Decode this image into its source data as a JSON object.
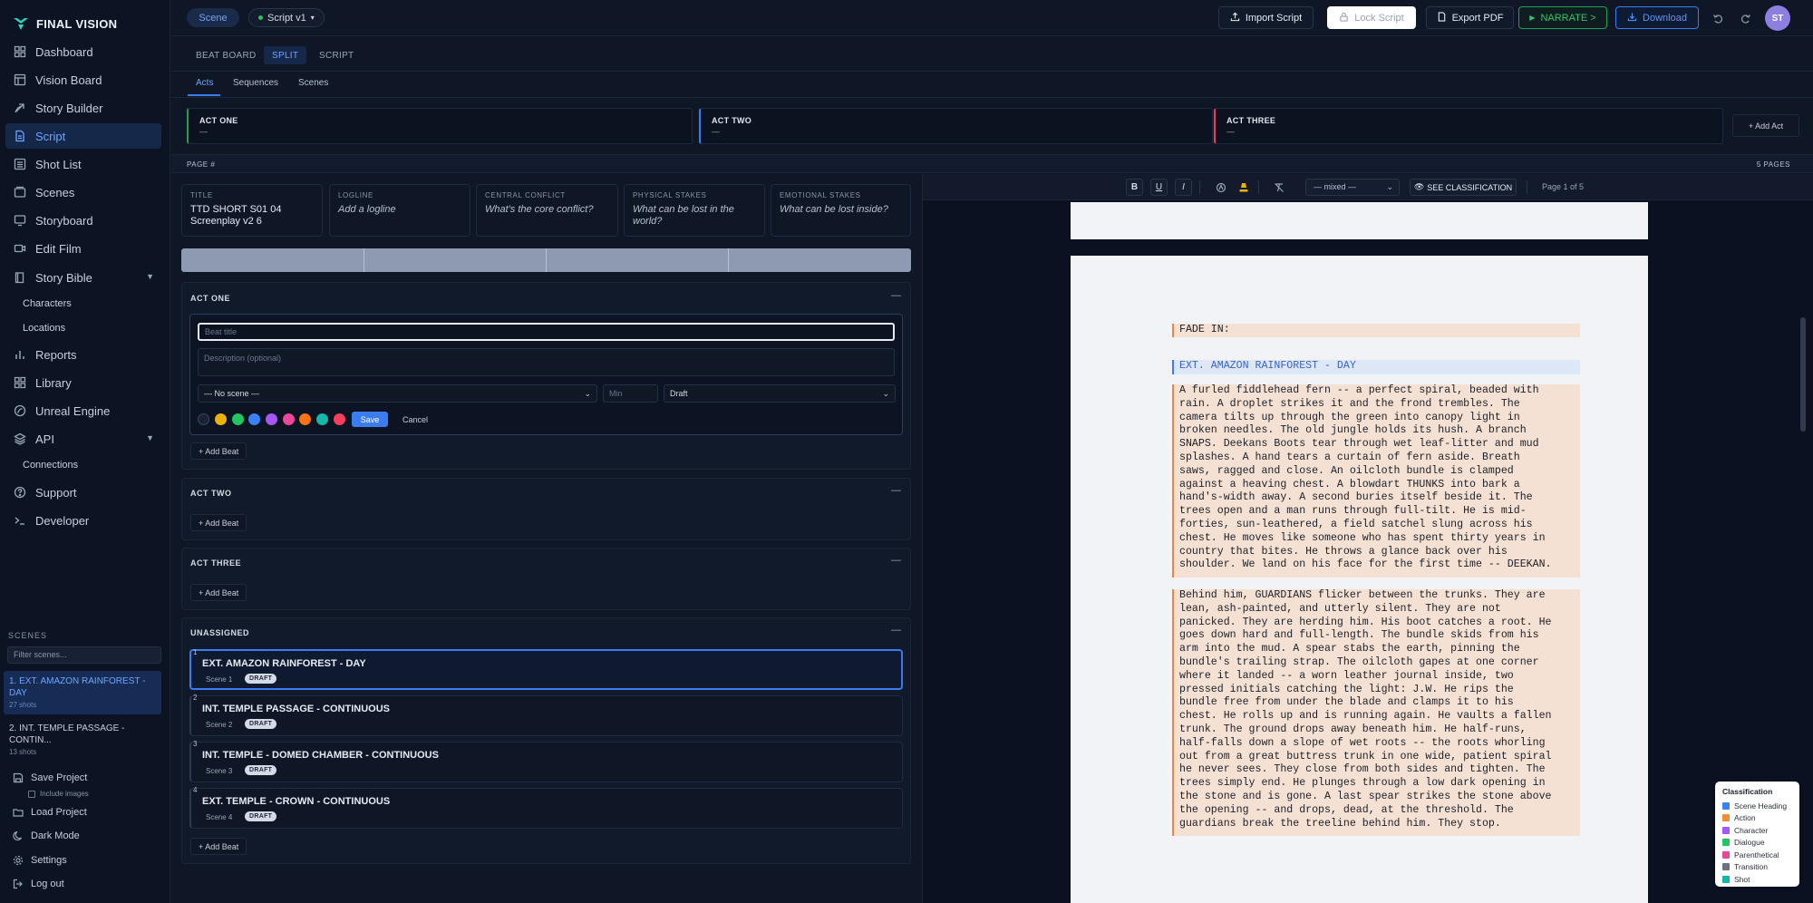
{
  "app": {
    "name": "FINAL VISION"
  },
  "sidebar": {
    "nav": [
      {
        "label": "Dashboard",
        "icon": "grid-icon"
      },
      {
        "label": "Vision Board",
        "icon": "layout-icon"
      },
      {
        "label": "Story Builder",
        "icon": "compass-icon"
      },
      {
        "label": "Script",
        "icon": "file-text-icon"
      },
      {
        "label": "Shot List",
        "icon": "list-icon"
      },
      {
        "label": "Scenes",
        "icon": "layers-icon"
      },
      {
        "label": "Storyboard",
        "icon": "monitor-icon"
      },
      {
        "label": "Edit Film",
        "icon": "video-icon"
      },
      {
        "label": "Story Bible",
        "icon": "book-icon"
      },
      {
        "label": "Reports",
        "icon": "bar-chart-icon"
      },
      {
        "label": "Library",
        "icon": "grid-icon"
      },
      {
        "label": "Unreal Engine",
        "icon": "globe-icon"
      },
      {
        "label": "API",
        "icon": "stack-icon"
      },
      {
        "label": "Support",
        "icon": "help-icon"
      },
      {
        "label": "Developer",
        "icon": "terminal-icon"
      }
    ],
    "story_bible_sub": [
      "Characters",
      "Locations"
    ],
    "api_sub": [
      "Connections"
    ],
    "scenes_heading": "SCENES",
    "scene_filter_placeholder": "Filter scenes...",
    "scenes": [
      {
        "title": "1. EXT. AMAZON RAINFOREST - DAY",
        "shots": "27 shots"
      },
      {
        "title": "2. INT. TEMPLE PASSAGE - CONTIN...",
        "shots": "13 shots"
      }
    ],
    "footer": {
      "save_project": "Save Project",
      "include_images": "Include images",
      "load_project": "Load Project",
      "dark_mode": "Dark Mode",
      "settings": "Settings",
      "logout": "Log out"
    }
  },
  "topbar": {
    "scene_pill": "Scene",
    "script_pill": "Script v1",
    "import_script": "Import Script",
    "lock_script": "Lock Script",
    "export_pdf": "Export PDF",
    "narrate": "NARRATE >",
    "download": "Download",
    "avatar_initials": "ST"
  },
  "mode_tabs": [
    "BEAT BOARD",
    "SPLIT",
    "SCRIPT"
  ],
  "sub_tabs": [
    "Acts",
    "Sequences",
    "Scenes"
  ],
  "acts_strip": [
    {
      "name": "ACT ONE",
      "desc": "—",
      "color": "#22a052"
    },
    {
      "name": "ACT TWO",
      "desc": "—",
      "color": "#3b7cf0"
    },
    {
      "name": "ACT THREE",
      "desc": "—",
      "color": "#e0435a"
    }
  ],
  "add_act": "+ Add Act",
  "page_band": {
    "left": "PAGE #",
    "right": "5 PAGES"
  },
  "info_cards": [
    {
      "label": "TITLE",
      "value": "TTD SHORT S01 04 Screenplay v2 6",
      "placeholder": false
    },
    {
      "label": "LOGLINE",
      "value": "Add a logline",
      "placeholder": true
    },
    {
      "label": "CENTRAL CONFLICT",
      "value": "What's the core conflict?",
      "placeholder": true
    },
    {
      "label": "PHYSICAL STAKES",
      "value": "What can be lost in the world?",
      "placeholder": true
    },
    {
      "label": "EMOTIONAL STAKES",
      "value": "What can be lost inside?",
      "placeholder": true
    }
  ],
  "sections": {
    "act_one": "ACT ONE",
    "act_two": "ACT TWO",
    "act_three": "ACT THREE",
    "unassigned": "UNASSIGNED",
    "collapse": "—",
    "add_beat": "+ Add Beat"
  },
  "beat_form": {
    "title_placeholder": "Beat title",
    "desc_placeholder": "Description (optional)",
    "scene_select": "— No scene —",
    "min_placeholder": "Min",
    "status_select": "Draft",
    "colors": [
      "#1b2236",
      "#eab308",
      "#22c55e",
      "#3b82f6",
      "#a855f7",
      "#ec4899",
      "#f97316",
      "#14b8a6",
      "#f43f5e"
    ],
    "save": "Save",
    "cancel": "Cancel"
  },
  "unassigned_scenes": [
    {
      "num": "1",
      "title": "EXT. AMAZON RAINFOREST - DAY",
      "sub": "Scene 1",
      "badge": "DRAFT"
    },
    {
      "num": "2",
      "title": "INT. TEMPLE PASSAGE - CONTINUOUS",
      "sub": "Scene 2",
      "badge": "DRAFT"
    },
    {
      "num": "3",
      "title": "INT. TEMPLE - DOMED CHAMBER - CONTINUOUS",
      "sub": "Scene 3",
      "badge": "DRAFT"
    },
    {
      "num": "4",
      "title": "EXT. TEMPLE - CROWN - CONTINUOUS",
      "sub": "Scene 4",
      "badge": "DRAFT"
    }
  ],
  "editor": {
    "bold": "B",
    "underline": "U",
    "italic": "I",
    "element_select": "— mixed —",
    "see_classification": "SEE CLASSIFICATION",
    "page_of": "Page 1 of 5"
  },
  "script": {
    "fade_in": "FADE IN:",
    "heading": "EXT. AMAZON RAINFOREST - DAY",
    "action1": "A furled fiddlehead fern -- a perfect spiral, beaded with\nrain. A droplet strikes it and the frond trembles. The\ncamera tilts up through the green into canopy light in\nbroken needles. The old jungle holds its hush. A branch\nSNAPS. Deekans Boots tear through wet leaf-litter and mud\nsplashes. A hand tears a curtain of fern aside. Breath\nsaws, ragged and close. An oilcloth bundle is clamped\nagainst a heaving chest. A blowdart THUNKS into bark a\nhand's-width away. A second buries itself beside it. The\ntrees open and a man runs through full-tilt. He is mid-\nforties, sun-leathered, a field satchel slung across his\nchest. He moves like someone who has spent thirty years in\ncountry that bites. He throws a glance back over his\nshoulder. We land on his face for the first time -- DEEKAN.",
    "action2": "Behind him, GUARDIANS flicker between the trunks. They are\nlean, ash-painted, and utterly silent. They are not\npanicked. They are herding him. His boot catches a root. He\ngoes down hard and full-length. The bundle skids from his\narm into the mud. A spear stabs the earth, pinning the\nbundle's trailing strap. The oilcloth gapes at one corner\nwhere it landed -- a worn leather journal inside, two\npressed initials catching the light: J.W. He rips the\nbundle free from under the blade and clamps it to his\nchest. He rolls up and is running again. He vaults a fallen\ntrunk. The ground drops away beneath him. He half-runs,\nhalf-falls down a slope of wet roots -- the roots whorling\nout from a great buttress trunk in one wide, patient spiral\nhe never sees. They close from both sides and tighten. The\ntrees simply end. He plunges through a low dark opening in\nthe stone and is gone. A last spear strikes the stone above\nthe opening -- and drops, dead, at the threshold. The\nguardians break the treeline behind him. They stop."
  },
  "legend": {
    "title": "Classification",
    "items": [
      {
        "label": "Scene Heading",
        "color": "#3b82f6"
      },
      {
        "label": "Action",
        "color": "#f28c38"
      },
      {
        "label": "Character",
        "color": "#a855f7"
      },
      {
        "label": "Dialogue",
        "color": "#22c55e"
      },
      {
        "label": "Parenthetical",
        "color": "#ec4899"
      },
      {
        "label": "Transition",
        "color": "#6b7280"
      },
      {
        "label": "Shot",
        "color": "#14b8a6"
      }
    ]
  }
}
